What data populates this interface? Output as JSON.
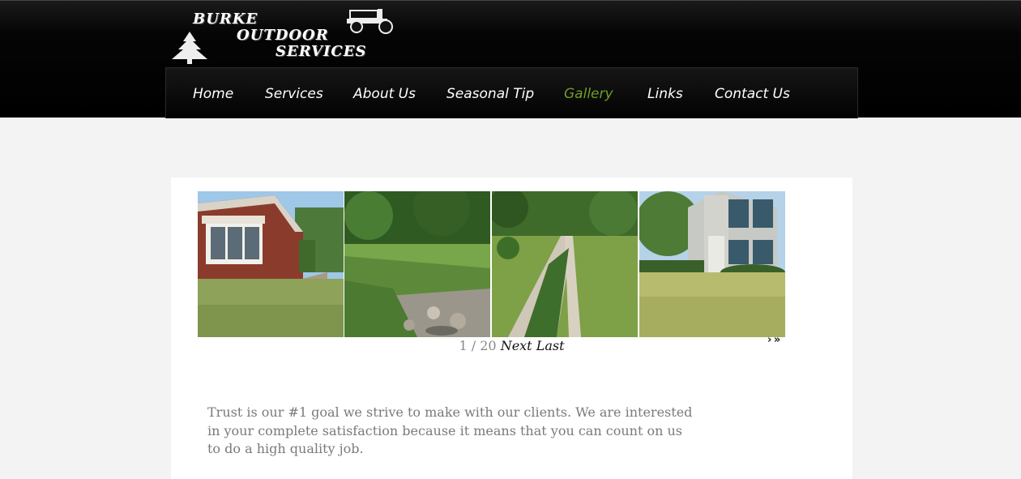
{
  "logo": {
    "line1": "BURKE",
    "line2": "OUTDOOR",
    "line3": "SERVICES",
    "icons": [
      "pine-tree-icon",
      "tractor-icon"
    ]
  },
  "nav": {
    "items": [
      {
        "label": "Home",
        "active": false
      },
      {
        "label": "Services",
        "active": false
      },
      {
        "label": "About Us",
        "active": false
      },
      {
        "label": "Seasonal Tip",
        "active": false
      },
      {
        "label": "Gallery",
        "active": true
      },
      {
        "label": "Links",
        "active": false
      },
      {
        "label": "Contact Us",
        "active": false
      }
    ],
    "active_color": "#6f9e2a"
  },
  "gallery": {
    "thumbnails": [
      "brick-house-photo",
      "garden-stream-photo",
      "rock-border-path-photo",
      "siding-house-photo"
    ],
    "pager": {
      "current": "1",
      "separator": "/",
      "total": "20",
      "next": "Next",
      "last": "Last"
    },
    "arrows": "›  »"
  },
  "intro_text": "Trust is our #1 goal we strive to make with our clients. We are interested in your complete satisfaction because it means that you can count on us to do a high quality job."
}
